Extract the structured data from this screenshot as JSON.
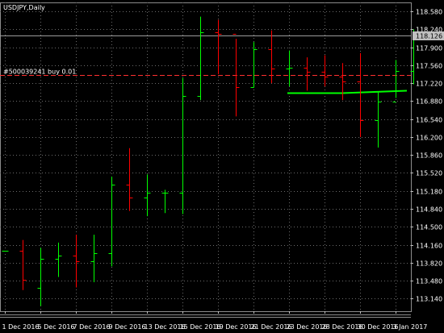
{
  "window": {
    "symbol_title": "USDJPY,Daily",
    "order_label": "#500039241 buy 0.01",
    "current_price_label": "118.126"
  },
  "colors": {
    "background": "#000000",
    "grid": "#6b6b6b",
    "bull": "#00ff00",
    "bear": "#ff0000",
    "axis_text": "#ffffff",
    "order_line": "#ff3030",
    "price_tag_bg": "#c0c0c0",
    "price_tag_text": "#000000"
  },
  "chart_data": {
    "type": "ohlc",
    "symbol": "USDJPY",
    "timeframe": "Daily",
    "y_ticks": [
      113.14,
      113.48,
      113.82,
      114.16,
      114.5,
      114.84,
      115.18,
      115.52,
      115.86,
      116.2,
      116.54,
      116.88,
      117.22,
      117.56,
      117.9,
      118.24,
      118.58
    ],
    "y_tick_labels": [
      "113.140",
      "113.480",
      "113.820",
      "114.160",
      "114.500",
      "114.840",
      "115.180",
      "115.520",
      "115.860",
      "116.200",
      "116.540",
      "116.880",
      "117.220",
      "117.560",
      "117.900",
      "118.240",
      "118.580"
    ],
    "ylim": [
      112.9,
      118.75
    ],
    "x_labels": [
      {
        "bar": 0,
        "text": "1 Dec 2016"
      },
      {
        "bar": 2,
        "text": "5 Dec 2016"
      },
      {
        "bar": 4,
        "text": "7 Dec 2016"
      },
      {
        "bar": 6,
        "text": "9 Dec 2016"
      },
      {
        "bar": 8,
        "text": "13 Dec 2016"
      },
      {
        "bar": 10,
        "text": "15 Dec 2016"
      },
      {
        "bar": 12,
        "text": "19 Dec 2016"
      },
      {
        "bar": 14,
        "text": "21 Dec 2016"
      },
      {
        "bar": 16,
        "text": "23 Dec 2016"
      },
      {
        "bar": 18,
        "text": "28 Dec 2016"
      },
      {
        "bar": 20,
        "text": "30 Dec 2016"
      },
      {
        "bar": 22,
        "text": "3 Jan 2017"
      }
    ],
    "bars": [
      {
        "o": 114.05,
        "h": 114.05,
        "l": 114.05,
        "c": 114.05
      },
      {
        "o": 114.05,
        "h": 114.25,
        "l": 113.3,
        "c": 113.5
      },
      {
        "o": 113.35,
        "h": 114.1,
        "l": 113.0,
        "c": 113.9
      },
      {
        "o": 113.9,
        "h": 114.2,
        "l": 113.55,
        "c": 113.95
      },
      {
        "o": 113.95,
        "h": 114.35,
        "l": 113.35,
        "c": 113.85
      },
      {
        "o": 113.85,
        "h": 114.35,
        "l": 113.45,
        "c": 114.0
      },
      {
        "o": 114.0,
        "h": 115.45,
        "l": 113.75,
        "c": 115.3
      },
      {
        "o": 115.3,
        "h": 115.99,
        "l": 114.8,
        "c": 115.05
      },
      {
        "o": 115.05,
        "h": 115.49,
        "l": 114.7,
        "c": 115.14
      },
      {
        "o": 115.14,
        "h": 115.2,
        "l": 114.76,
        "c": 115.14
      },
      {
        "o": 115.14,
        "h": 117.32,
        "l": 114.74,
        "c": 116.98
      },
      {
        "o": 116.98,
        "h": 118.48,
        "l": 116.9,
        "c": 118.18
      },
      {
        "o": 118.18,
        "h": 118.42,
        "l": 117.39,
        "c": 118.15
      },
      {
        "o": 118.15,
        "h": 118.06,
        "l": 116.59,
        "c": 117.14
      },
      {
        "o": 117.14,
        "h": 118.0,
        "l": 117.14,
        "c": 117.86
      },
      {
        "o": 117.86,
        "h": 118.22,
        "l": 117.22,
        "c": 117.5
      },
      {
        "o": 117.5,
        "h": 117.84,
        "l": 117.16,
        "c": 117.52
      },
      {
        "o": 117.52,
        "h": 117.71,
        "l": 117.08,
        "c": 117.43
      },
      {
        "o": 117.43,
        "h": 117.75,
        "l": 117.16,
        "c": 117.34
      },
      {
        "o": 117.34,
        "h": 117.6,
        "l": 116.9,
        "c": 117.26
      },
      {
        "o": 117.26,
        "h": 117.79,
        "l": 116.2,
        "c": 116.52
      },
      {
        "o": 116.52,
        "h": 117.05,
        "l": 116.0,
        "c": 116.87
      },
      {
        "o": 116.87,
        "h": 117.66,
        "l": 116.94,
        "c": 117.45
      },
      {
        "o": 117.45,
        "h": 118.24,
        "l": 117.2,
        "c": 118.13
      }
    ],
    "order_level": 117.38,
    "position_level": 117.04,
    "current_price": 118.126
  }
}
